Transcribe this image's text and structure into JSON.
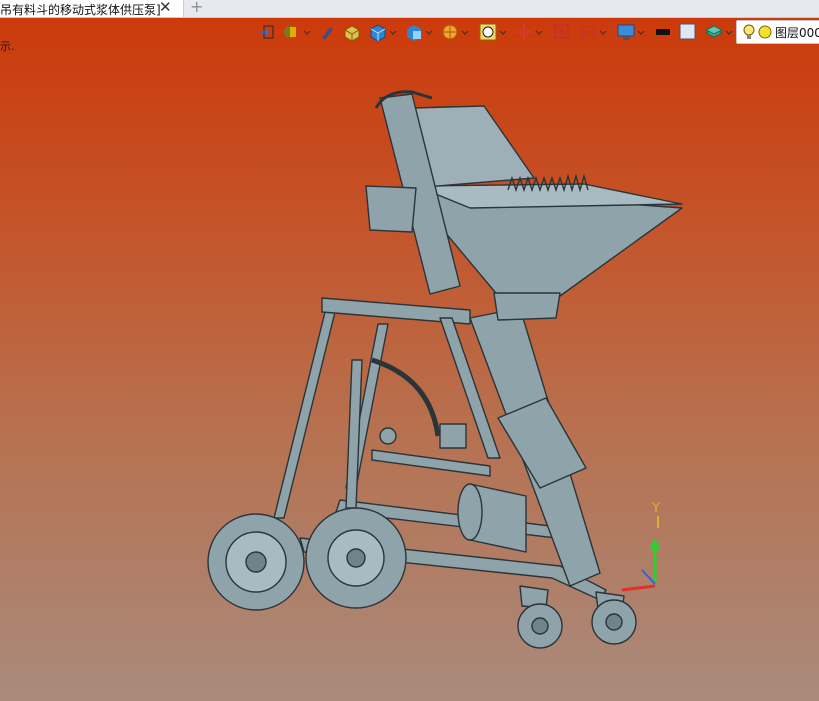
{
  "tab": {
    "title": "吊有料斗的移动式浆体供压泵]",
    "close": "✕",
    "add": "+"
  },
  "viewport": {
    "hint": "示."
  },
  "toolbar": {
    "items": [
      "exit-sketch-icon",
      "style-icon",
      "pen-icon",
      "box-icon",
      "cube-icon",
      "render-mode-icon",
      "section-icon",
      "zoom-icon",
      "move-icon",
      "frame-icon",
      "align-icon",
      "monitor-icon",
      "color-swatch-icon",
      "layer-stack-icon"
    ],
    "layer": {
      "label": "图层000",
      "bulb_icon": "lightbulb-icon",
      "dot_icon": "layer-color-dot"
    }
  },
  "triad": {
    "y_label": "Y"
  },
  "colors": {
    "tab_bg": "#ffffff",
    "viewport_top": "#cc3a0a",
    "viewport_bottom": "#a98a7c",
    "model_fill": "#8fa3ab",
    "model_edge": "#2b3438",
    "axis_y": "#2fcf2f",
    "axis_x": "#e0302a"
  }
}
